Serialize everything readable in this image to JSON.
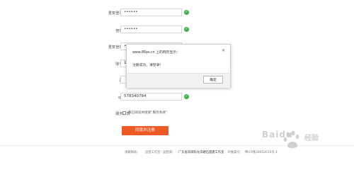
{
  "form": {
    "rows": [
      {
        "label": "重复登录密码",
        "value": "••••••"
      },
      {
        "label": "管理密码",
        "value": "••••••"
      },
      {
        "label": "重复管理密码",
        "value": "••••••"
      },
      {
        "label": "账号手机",
        "value": "1"
      },
      {
        "label": "验证码",
        "value": ""
      },
      {
        "label": "qq号码",
        "value": "578340784"
      }
    ],
    "terms_label": "服务条款",
    "terms_checkbox_text": "我已阅读并接受“服务条款”",
    "submit_label": "同意并注册"
  },
  "dialog": {
    "title": "www.86ps.cn 上的网页显示：",
    "message": "注册成功，请登录！",
    "close_glyph": "✕",
    "ok_label": "确定"
  },
  "footer": {
    "items": [
      "承载网站：",
      "运营工作室：",
      "运营商：",
      "广东省深圳科光华硬石盟建工作室",
      "IP备案号：",
      "粤ICP备18052016号-1"
    ]
  },
  "watermark": {
    "brand": "Baidu",
    "sub": "经验"
  },
  "colors": {
    "accent": "#ee5a24",
    "valid": "#3db34a"
  }
}
